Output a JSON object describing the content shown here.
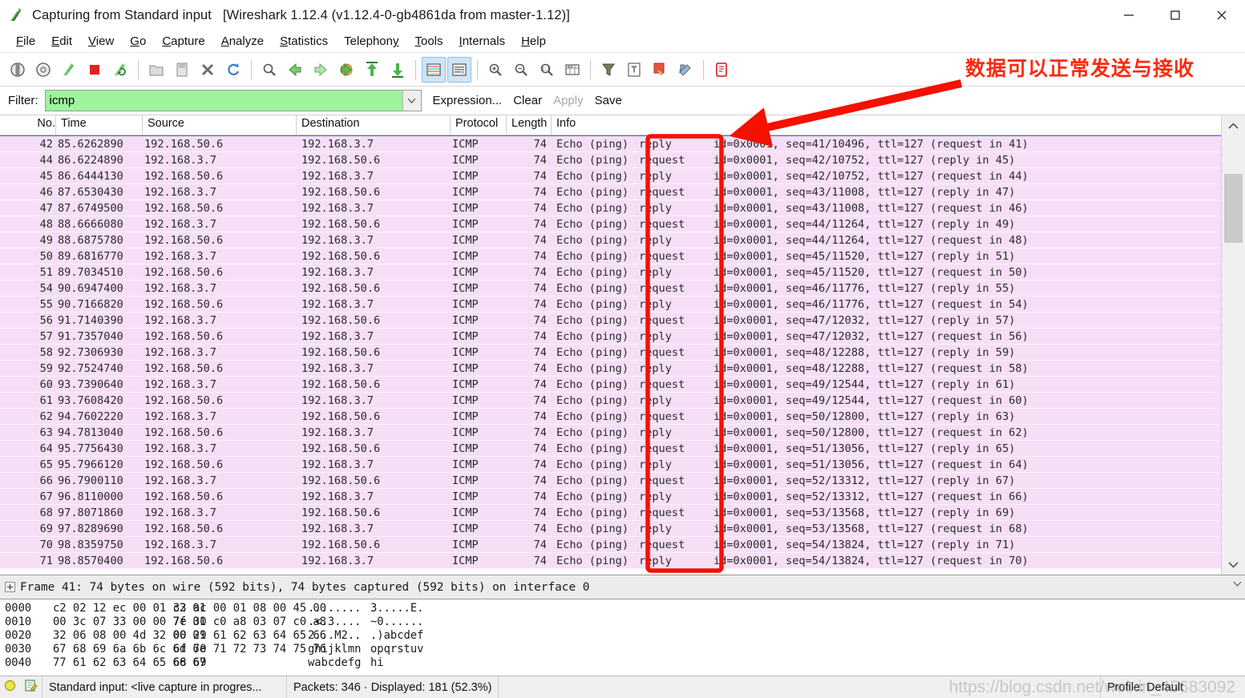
{
  "window": {
    "title": "Capturing from Standard input",
    "version": "[Wireshark 1.12.4  (v1.12.4-0-gb4861da from master-1.12)]",
    "app_icon": "wireshark-fin-icon",
    "minimize_label": "—",
    "maximize_label": "□",
    "close_label": "✕"
  },
  "menu": {
    "items": [
      {
        "label": "File",
        "accel": "F"
      },
      {
        "label": "Edit",
        "accel": "E"
      },
      {
        "label": "View",
        "accel": "V"
      },
      {
        "label": "Go",
        "accel": "G"
      },
      {
        "label": "Capture",
        "accel": "C"
      },
      {
        "label": "Analyze",
        "accel": "A"
      },
      {
        "label": "Statistics",
        "accel": "S"
      },
      {
        "label": "Telephony",
        "accel": "y"
      },
      {
        "label": "Tools",
        "accel": "T"
      },
      {
        "label": "Internals",
        "accel": "I"
      },
      {
        "label": "Help",
        "accel": "H"
      }
    ]
  },
  "toolbar": {
    "buttons": [
      {
        "name": "interfaces-icon",
        "kind": "icon"
      },
      {
        "name": "capture-options-icon",
        "kind": "icon"
      },
      {
        "name": "start-capture-icon",
        "kind": "icon"
      },
      {
        "name": "stop-capture-icon",
        "kind": "icon"
      },
      {
        "name": "restart-capture-icon",
        "kind": "icon"
      },
      {
        "name": "separator",
        "kind": "sep"
      },
      {
        "name": "open-file-icon",
        "kind": "icon"
      },
      {
        "name": "save-file-icon",
        "kind": "icon"
      },
      {
        "name": "close-file-icon",
        "kind": "icon"
      },
      {
        "name": "reload-file-icon",
        "kind": "icon"
      },
      {
        "name": "separator",
        "kind": "sep"
      },
      {
        "name": "find-packet-icon",
        "kind": "icon"
      },
      {
        "name": "go-back-icon",
        "kind": "icon"
      },
      {
        "name": "go-forward-icon",
        "kind": "icon"
      },
      {
        "name": "go-to-packet-icon",
        "kind": "icon"
      },
      {
        "name": "go-to-first-packet-icon",
        "kind": "icon"
      },
      {
        "name": "go-to-last-packet-icon",
        "kind": "icon"
      },
      {
        "name": "separator",
        "kind": "sep"
      },
      {
        "name": "colorize-packet-list-icon",
        "kind": "icon",
        "active": true
      },
      {
        "name": "auto-scroll-live-capture-icon",
        "kind": "icon",
        "active": true
      },
      {
        "name": "separator",
        "kind": "sep"
      },
      {
        "name": "zoom-in-icon",
        "kind": "icon"
      },
      {
        "name": "zoom-out-icon",
        "kind": "icon"
      },
      {
        "name": "normal-size-icon",
        "kind": "icon"
      },
      {
        "name": "resize-columns-icon",
        "kind": "icon"
      },
      {
        "name": "separator",
        "kind": "sep"
      },
      {
        "name": "capture-filters-icon",
        "kind": "icon"
      },
      {
        "name": "display-filters-icon",
        "kind": "icon"
      },
      {
        "name": "coloring-rules-icon",
        "kind": "icon"
      },
      {
        "name": "preferences-icon",
        "kind": "icon"
      },
      {
        "name": "separator",
        "kind": "sep"
      },
      {
        "name": "help-contents-icon",
        "kind": "icon"
      }
    ]
  },
  "filter": {
    "label": "Filter:",
    "value": "icmp",
    "placeholder": "",
    "dropdown_icon": "chevron-down-icon",
    "expression_label": "Expression...",
    "clear_label": "Clear",
    "apply_label": "Apply",
    "apply_disabled": true,
    "save_label": "Save",
    "field_background": "#9ef39e"
  },
  "packet_list": {
    "columns": [
      "No.",
      "Time",
      "Source",
      "Destination",
      "Protocol",
      "Length",
      "Info"
    ],
    "row_background": "#f6dff6",
    "rows": [
      {
        "no": "42",
        "time": "85.6262890",
        "src": "192.168.50.6",
        "dst": "192.168.3.7",
        "proto": "ICMP",
        "len": "74",
        "echo": "Echo (ping)",
        "kind": "reply",
        "info": "id=0x0001, seq=41/10496, ttl=127 (request in 41)"
      },
      {
        "no": "44",
        "time": "86.6224890",
        "src": "192.168.3.7",
        "dst": "192.168.50.6",
        "proto": "ICMP",
        "len": "74",
        "echo": "Echo (ping)",
        "kind": "request",
        "info": "id=0x0001, seq=42/10752, ttl=127 (reply in 45)"
      },
      {
        "no": "45",
        "time": "86.6444130",
        "src": "192.168.50.6",
        "dst": "192.168.3.7",
        "proto": "ICMP",
        "len": "74",
        "echo": "Echo (ping)",
        "kind": "reply",
        "info": "id=0x0001, seq=42/10752, ttl=127 (request in 44)"
      },
      {
        "no": "46",
        "time": "87.6530430",
        "src": "192.168.3.7",
        "dst": "192.168.50.6",
        "proto": "ICMP",
        "len": "74",
        "echo": "Echo (ping)",
        "kind": "request",
        "info": "id=0x0001, seq=43/11008, ttl=127 (reply in 47)"
      },
      {
        "no": "47",
        "time": "87.6749500",
        "src": "192.168.50.6",
        "dst": "192.168.3.7",
        "proto": "ICMP",
        "len": "74",
        "echo": "Echo (ping)",
        "kind": "reply",
        "info": "id=0x0001, seq=43/11008, ttl=127 (request in 46)"
      },
      {
        "no": "48",
        "time": "88.6666080",
        "src": "192.168.3.7",
        "dst": "192.168.50.6",
        "proto": "ICMP",
        "len": "74",
        "echo": "Echo (ping)",
        "kind": "request",
        "info": "id=0x0001, seq=44/11264, ttl=127 (reply in 49)"
      },
      {
        "no": "49",
        "time": "88.6875780",
        "src": "192.168.50.6",
        "dst": "192.168.3.7",
        "proto": "ICMP",
        "len": "74",
        "echo": "Echo (ping)",
        "kind": "reply",
        "info": "id=0x0001, seq=44/11264, ttl=127 (request in 48)"
      },
      {
        "no": "50",
        "time": "89.6816770",
        "src": "192.168.3.7",
        "dst": "192.168.50.6",
        "proto": "ICMP",
        "len": "74",
        "echo": "Echo (ping)",
        "kind": "request",
        "info": "id=0x0001, seq=45/11520, ttl=127 (reply in 51)"
      },
      {
        "no": "51",
        "time": "89.7034510",
        "src": "192.168.50.6",
        "dst": "192.168.3.7",
        "proto": "ICMP",
        "len": "74",
        "echo": "Echo (ping)",
        "kind": "reply",
        "info": "id=0x0001, seq=45/11520, ttl=127 (request in 50)"
      },
      {
        "no": "54",
        "time": "90.6947400",
        "src": "192.168.3.7",
        "dst": "192.168.50.6",
        "proto": "ICMP",
        "len": "74",
        "echo": "Echo (ping)",
        "kind": "request",
        "info": "id=0x0001, seq=46/11776, ttl=127 (reply in 55)"
      },
      {
        "no": "55",
        "time": "90.7166820",
        "src": "192.168.50.6",
        "dst": "192.168.3.7",
        "proto": "ICMP",
        "len": "74",
        "echo": "Echo (ping)",
        "kind": "reply",
        "info": "id=0x0001, seq=46/11776, ttl=127 (request in 54)"
      },
      {
        "no": "56",
        "time": "91.7140390",
        "src": "192.168.3.7",
        "dst": "192.168.50.6",
        "proto": "ICMP",
        "len": "74",
        "echo": "Echo (ping)",
        "kind": "request",
        "info": "id=0x0001, seq=47/12032, ttl=127 (reply in 57)"
      },
      {
        "no": "57",
        "time": "91.7357040",
        "src": "192.168.50.6",
        "dst": "192.168.3.7",
        "proto": "ICMP",
        "len": "74",
        "echo": "Echo (ping)",
        "kind": "reply",
        "info": "id=0x0001, seq=47/12032, ttl=127 (request in 56)"
      },
      {
        "no": "58",
        "time": "92.7306930",
        "src": "192.168.3.7",
        "dst": "192.168.50.6",
        "proto": "ICMP",
        "len": "74",
        "echo": "Echo (ping)",
        "kind": "request",
        "info": "id=0x0001, seq=48/12288, ttl=127 (reply in 59)"
      },
      {
        "no": "59",
        "time": "92.7524740",
        "src": "192.168.50.6",
        "dst": "192.168.3.7",
        "proto": "ICMP",
        "len": "74",
        "echo": "Echo (ping)",
        "kind": "reply",
        "info": "id=0x0001, seq=48/12288, ttl=127 (request in 58)"
      },
      {
        "no": "60",
        "time": "93.7390640",
        "src": "192.168.3.7",
        "dst": "192.168.50.6",
        "proto": "ICMP",
        "len": "74",
        "echo": "Echo (ping)",
        "kind": "request",
        "info": "id=0x0001, seq=49/12544, ttl=127 (reply in 61)"
      },
      {
        "no": "61",
        "time": "93.7608420",
        "src": "192.168.50.6",
        "dst": "192.168.3.7",
        "proto": "ICMP",
        "len": "74",
        "echo": "Echo (ping)",
        "kind": "reply",
        "info": "id=0x0001, seq=49/12544, ttl=127 (request in 60)"
      },
      {
        "no": "62",
        "time": "94.7602220",
        "src": "192.168.3.7",
        "dst": "192.168.50.6",
        "proto": "ICMP",
        "len": "74",
        "echo": "Echo (ping)",
        "kind": "request",
        "info": "id=0x0001, seq=50/12800, ttl=127 (reply in 63)"
      },
      {
        "no": "63",
        "time": "94.7813040",
        "src": "192.168.50.6",
        "dst": "192.168.3.7",
        "proto": "ICMP",
        "len": "74",
        "echo": "Echo (ping)",
        "kind": "reply",
        "info": "id=0x0001, seq=50/12800, ttl=127 (request in 62)"
      },
      {
        "no": "64",
        "time": "95.7756430",
        "src": "192.168.3.7",
        "dst": "192.168.50.6",
        "proto": "ICMP",
        "len": "74",
        "echo": "Echo (ping)",
        "kind": "request",
        "info": "id=0x0001, seq=51/13056, ttl=127 (reply in 65)"
      },
      {
        "no": "65",
        "time": "95.7966120",
        "src": "192.168.50.6",
        "dst": "192.168.3.7",
        "proto": "ICMP",
        "len": "74",
        "echo": "Echo (ping)",
        "kind": "reply",
        "info": "id=0x0001, seq=51/13056, ttl=127 (request in 64)"
      },
      {
        "no": "66",
        "time": "96.7900110",
        "src": "192.168.3.7",
        "dst": "192.168.50.6",
        "proto": "ICMP",
        "len": "74",
        "echo": "Echo (ping)",
        "kind": "request",
        "info": "id=0x0001, seq=52/13312, ttl=127 (reply in 67)"
      },
      {
        "no": "67",
        "time": "96.8110000",
        "src": "192.168.50.6",
        "dst": "192.168.3.7",
        "proto": "ICMP",
        "len": "74",
        "echo": "Echo (ping)",
        "kind": "reply",
        "info": "id=0x0001, seq=52/13312, ttl=127 (request in 66)"
      },
      {
        "no": "68",
        "time": "97.8071860",
        "src": "192.168.3.7",
        "dst": "192.168.50.6",
        "proto": "ICMP",
        "len": "74",
        "echo": "Echo (ping)",
        "kind": "request",
        "info": "id=0x0001, seq=53/13568, ttl=127 (reply in 69)"
      },
      {
        "no": "69",
        "time": "97.8289690",
        "src": "192.168.50.6",
        "dst": "192.168.3.7",
        "proto": "ICMP",
        "len": "74",
        "echo": "Echo (ping)",
        "kind": "reply",
        "info": "id=0x0001, seq=53/13568, ttl=127 (request in 68)"
      },
      {
        "no": "70",
        "time": "98.8359750",
        "src": "192.168.3.7",
        "dst": "192.168.50.6",
        "proto": "ICMP",
        "len": "74",
        "echo": "Echo (ping)",
        "kind": "request",
        "info": "id=0x0001, seq=54/13824, ttl=127 (reply in 71)"
      },
      {
        "no": "71",
        "time": "98.8570400",
        "src": "192.168.50.6",
        "dst": "192.168.3.7",
        "proto": "ICMP",
        "len": "74",
        "echo": "Echo (ping)",
        "kind": "reply",
        "info": "id=0x0001, seq=54/13824, ttl=127 (request in 70)"
      }
    ],
    "scroll_up_icon": "chevron-up-icon",
    "scroll_down_icon": "chevron-down-icon"
  },
  "detail_pane": {
    "frame_line": "Frame 41: 74 bytes on wire (592 bits), 74 bytes captured (592 bits) on interface 0",
    "expander_icon": "plus-box-icon"
  },
  "hex_pane": {
    "rows": [
      {
        "offset": "0000",
        "b1": "c2 02 12 ec 00 01 c2 01",
        "b2": "33 ac 00 01 08 00 45 00",
        "a1": "........",
        "a2": "3.....E."
      },
      {
        "offset": "0010",
        "b1": "00 3c 07 33 00 00 7f 01",
        "b2": "7e 30 c0 a8 03 07 c0 a8",
        "a1": ".<.3....",
        "a2": "~0......"
      },
      {
        "offset": "0020",
        "b1": "32 06 08 00 4d 32 00 01",
        "b2": "00 29 61 62 63 64 65 66",
        "a1": "2...M2..",
        "a2": ".)abcdef"
      },
      {
        "offset": "0030",
        "b1": "67 68 69 6a 6b 6c 6d 6e",
        "b2": "6f 70 71 72 73 74 75 76",
        "a1": "ghijklmn",
        "a2": "opqrstuv"
      },
      {
        "offset": "0040",
        "b1": "77 61 62 63 64 65 66 67",
        "b2": "68 69",
        "a1": "wabcdefg",
        "a2": "hi"
      }
    ]
  },
  "statusbar": {
    "expert_icon": "expert-info-circle-icon",
    "annotation_icon": "capture-comment-icon",
    "capture_text": "Standard input: <live capture in progres...",
    "packets_text": "Packets: 346 · Displayed: 181 (52.3%)",
    "profile_text": "Profile: Default"
  },
  "annotations": {
    "note_text": "数据可以正常发送与接收",
    "note_color": "#fb2a10",
    "highlight_color": "#f51000",
    "arrow_name": "red-arrow-annotation",
    "rect_name": "red-highlight-rectangle"
  },
  "watermark": {
    "text": "https://blog.csdn.net/weixin_45683092"
  }
}
